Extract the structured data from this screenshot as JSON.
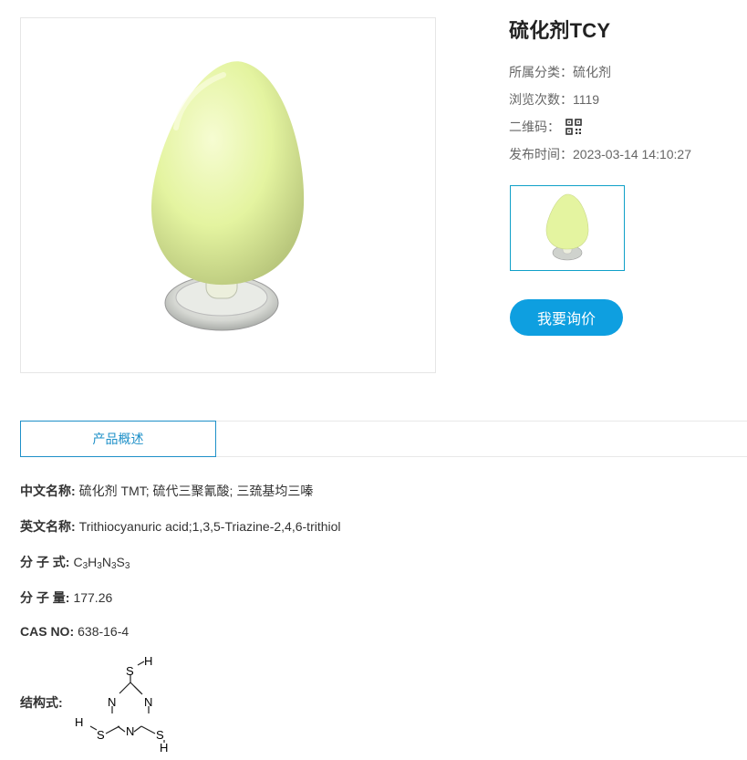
{
  "product": {
    "title": "硫化剂TCY",
    "category_label": "所属分类：",
    "category_value": "硫化剂",
    "views_label": "浏览次数：",
    "views_value": "1119",
    "qr_label": "二维码：",
    "date_label": "发布时间：",
    "date_value": "2023-03-14 14:10:27",
    "inquiry_label": "我要询价"
  },
  "tabs": [
    {
      "label": "产品概述"
    }
  ],
  "details": {
    "cn_name_label": "中文名称:",
    "cn_name_value": "硫化剂 TMT; 硫代三聚氰酸; 三巯基均三嗪",
    "en_name_label": "英文名称:",
    "en_name_value": "Trithiocyanuric acid;1,3,5-Triazine-2,4,6-trithiol",
    "formula_label": "分 子 式:",
    "formula_parts": [
      "C",
      "3",
      "H",
      "3",
      "N",
      "3",
      "S",
      "3"
    ],
    "mw_label": "分 子 量:",
    "mw_value": "177.26",
    "cas_label": "CAS  NO:",
    "cas_value": "638-16-4",
    "structure_label": "结构式:",
    "structure_atoms": {
      "n": "N",
      "s": "S",
      "h": "H"
    }
  },
  "colors": {
    "accent": "#0e9fe0",
    "tab_border": "#1e90c8",
    "powder": "#e6f5a6",
    "base": "#cfd3cf"
  },
  "icons": [
    "qr-code-icon"
  ]
}
